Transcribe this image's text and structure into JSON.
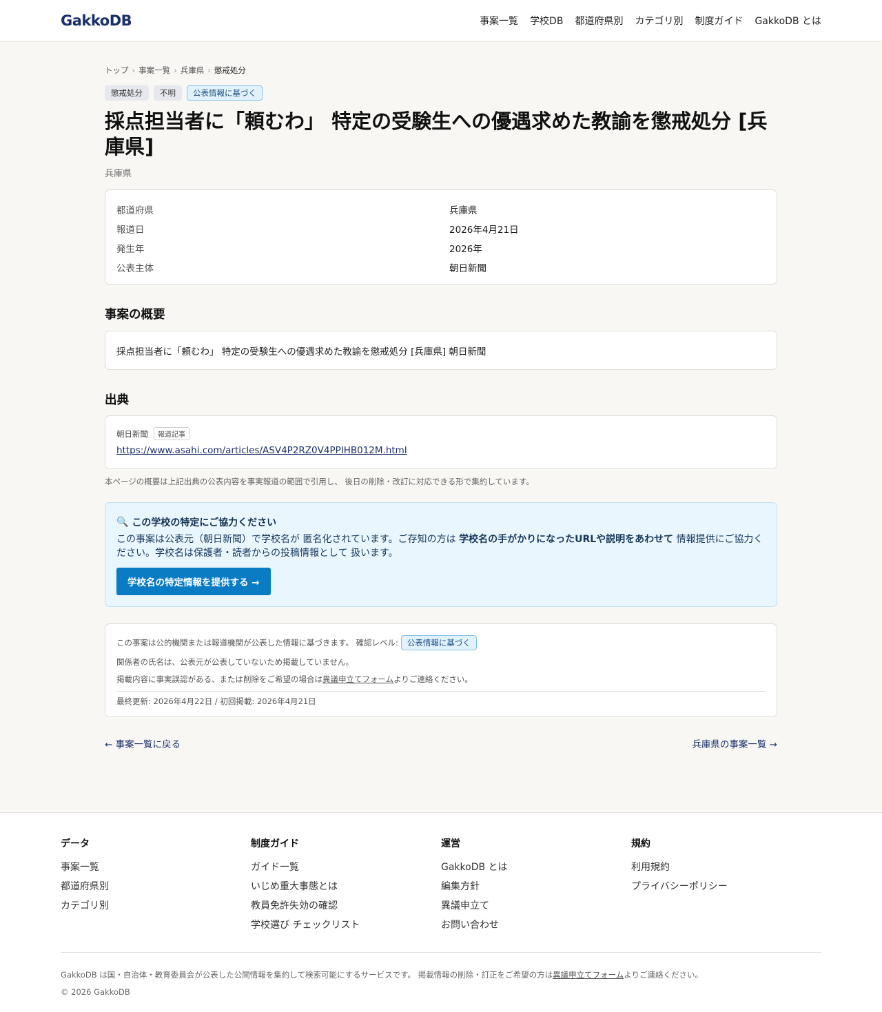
{
  "header": {
    "logo_part1": "Gakko",
    "logo_part2": "DB",
    "nav": [
      "事案一覧",
      "学校DB",
      "都道府県別",
      "カテゴリ別",
      "制度ガイド",
      "GakkoDB とは"
    ]
  },
  "breadcrumb": [
    "トップ",
    "事案一覧",
    "兵庫県",
    "懲戒処分"
  ],
  "breadcrumb_sep": "›",
  "badges": [
    "懲戒処分",
    "不明",
    "公表情報に基づく"
  ],
  "title": "採点担当者に「頼むわ」 特定の受験生への優遇求めた教諭を懲戒処分 [兵庫県]",
  "subtitle": "兵庫県",
  "meta": [
    {
      "key": "都道府県",
      "value": "兵庫県"
    },
    {
      "key": "報道日",
      "value": "2026年4月21日"
    },
    {
      "key": "発生年",
      "value": "2026年"
    },
    {
      "key": "公表主体",
      "value": "朝日新聞"
    }
  ],
  "summary": {
    "heading": "事案の概要",
    "text": "採点担当者に「頼むわ」 特定の受験生への優遇求めた教諭を懲戒処分 [兵庫県] 朝日新聞"
  },
  "source": {
    "heading": "出典",
    "name": "朝日新聞",
    "tag": "報道記事",
    "url": "https://www.asahi.com/articles/ASV4P2RZ0V4PPIHB012M.html",
    "note": "本ページの概要は上記出典の公表内容を事実報道の範囲で引用し、 後日の削除・改訂に対応できる形で集約しています。"
  },
  "help": {
    "icon": "🔍",
    "title": "この学校の特定にご協力ください",
    "text_1": "この事案は公表元（朝日新聞）で学校名が 匿名化されています。ご存知の方は ",
    "text_bold": "学校名の手がかりになったURLや説明をあわせて",
    "text_2": " 情報提供にご協力ください。学校名は保護者・読者からの投稿情報として 扱います。",
    "button": "学校名の特定情報を提供する →"
  },
  "notice": {
    "line1": "この事案は公的機関または報道機関が公表した情報に基づきます。 確認レベル:",
    "level_badge": "公表情報に基づく",
    "line2": "関係者の氏名は、公表元が公表していないため掲載していません。",
    "line3_pre": "掲載内容に事実誤認がある、または削除をご希望の場合は",
    "line3_link": "異議申立てフォーム",
    "line3_post": "よりご連絡ください。",
    "dates": "最終更新: 2026年4月22日 / 初回掲載: 2026年4月21日"
  },
  "bottom_links": {
    "back": "← 事案一覧に戻る",
    "prefecture": "兵庫県の事案一覧 →"
  },
  "footer": {
    "columns": [
      {
        "heading": "データ",
        "items": [
          "事案一覧",
          "都道府県別",
          "カテゴリ別"
        ]
      },
      {
        "heading": "制度ガイド",
        "items": [
          "ガイド一覧",
          "いじめ重大事態とは",
          "教員免許失効の確認",
          "学校選び チェックリスト"
        ]
      },
      {
        "heading": "運営",
        "items": [
          "GakkoDB とは",
          "編集方針",
          "異議申立て",
          "お問い合わせ"
        ]
      },
      {
        "heading": "規約",
        "items": [
          "利用規約",
          "プライバシーポリシー"
        ]
      }
    ],
    "desc_pre": "GakkoDB は国・自治体・教育委員会が公表した公開情報を集約して検索可能にするサービスです。 掲載情報の削除・訂正をご希望の方は",
    "desc_link": "異議申立てフォーム",
    "desc_post": "よりご連絡ください。",
    "copyright": "© 2026 GakkoDB"
  }
}
